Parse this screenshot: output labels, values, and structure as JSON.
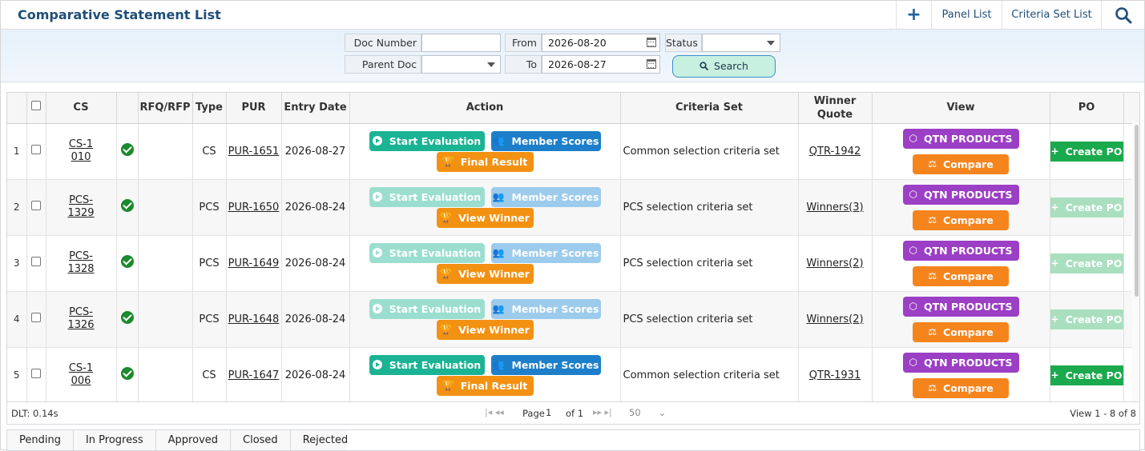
{
  "header": {
    "title": "Comparative Statement List",
    "add_label": "+",
    "panel_list": "Panel List",
    "criteria_set_list": "Criteria Set List"
  },
  "filter": {
    "doc_number_label": "Doc Number",
    "doc_number_value": "",
    "parent_doc_label": "Parent Doc",
    "parent_doc_value": "",
    "from_label": "From",
    "from_value": "2026-08-20",
    "to_label": "To",
    "to_value": "2026-08-27",
    "status_label": "Status",
    "status_value": "",
    "search_label": "Search"
  },
  "table": {
    "columns": [
      "CS",
      "RFQ/RFP",
      "Type",
      "PUR",
      "Entry Date",
      "Action",
      "Criteria Set",
      "Winner Quote",
      "View",
      "PO"
    ],
    "rows": [
      {
        "num": "1",
        "cs": "CS-1010",
        "type": "CS",
        "pur": "PUR-1651",
        "date": "2026-08-27",
        "start": "Start Evaluation",
        "member": "Member Scores",
        "third": "Final Result",
        "enabled": true,
        "criteria": "Common selection criteria set",
        "winner": "QTR-1942",
        "qtn": "QTN PRODUCTS",
        "compare": "Compare",
        "po": "Create PO",
        "po_enabled": true
      },
      {
        "num": "2",
        "cs": "PCS-1329",
        "type": "PCS",
        "pur": "PUR-1650",
        "date": "2026-08-24",
        "start": "Start Evaluation",
        "member": "Member Scores",
        "third": "View Winner",
        "enabled": false,
        "criteria": "PCS selection criteria set",
        "winner": "Winners(3)",
        "qtn": "QTN PRODUCTS",
        "compare": "Compare",
        "po": "Create PO",
        "po_enabled": false
      },
      {
        "num": "3",
        "cs": "PCS-1328",
        "type": "PCS",
        "pur": "PUR-1649",
        "date": "2026-08-24",
        "start": "Start Evaluation",
        "member": "Member Scores",
        "third": "View Winner",
        "enabled": false,
        "criteria": "PCS selection criteria set",
        "winner": "Winners(2)",
        "qtn": "QTN PRODUCTS",
        "compare": "Compare",
        "po": "Create PO",
        "po_enabled": false
      },
      {
        "num": "4",
        "cs": "PCS-1326",
        "type": "PCS",
        "pur": "PUR-1648",
        "date": "2026-08-24",
        "start": "Start Evaluation",
        "member": "Member Scores",
        "third": "View Winner",
        "enabled": false,
        "criteria": "PCS selection criteria set",
        "winner": "Winners(2)",
        "qtn": "QTN PRODUCTS",
        "compare": "Compare",
        "po": "Create PO",
        "po_enabled": false
      },
      {
        "num": "5",
        "cs": "CS-1006",
        "type": "CS",
        "pur": "PUR-1647",
        "date": "2026-08-24",
        "start": "Start Evaluation",
        "member": "Member Scores",
        "third": "Final Result",
        "enabled": true,
        "criteria": "Common selection criteria set",
        "winner": "QTR-1931",
        "qtn": "QTN PRODUCTS",
        "compare": "Compare",
        "po": "Create PO",
        "po_enabled": true
      }
    ]
  },
  "pager": {
    "dlt": "DLT: 0.14s",
    "page_label": "Page",
    "page_value": "1",
    "of_label": "of 1",
    "page_size": "50",
    "view_text": "View 1 - 8 of 8"
  },
  "status_tabs": [
    "Pending",
    "In Progress",
    "Approved",
    "Closed",
    "Rejected"
  ]
}
